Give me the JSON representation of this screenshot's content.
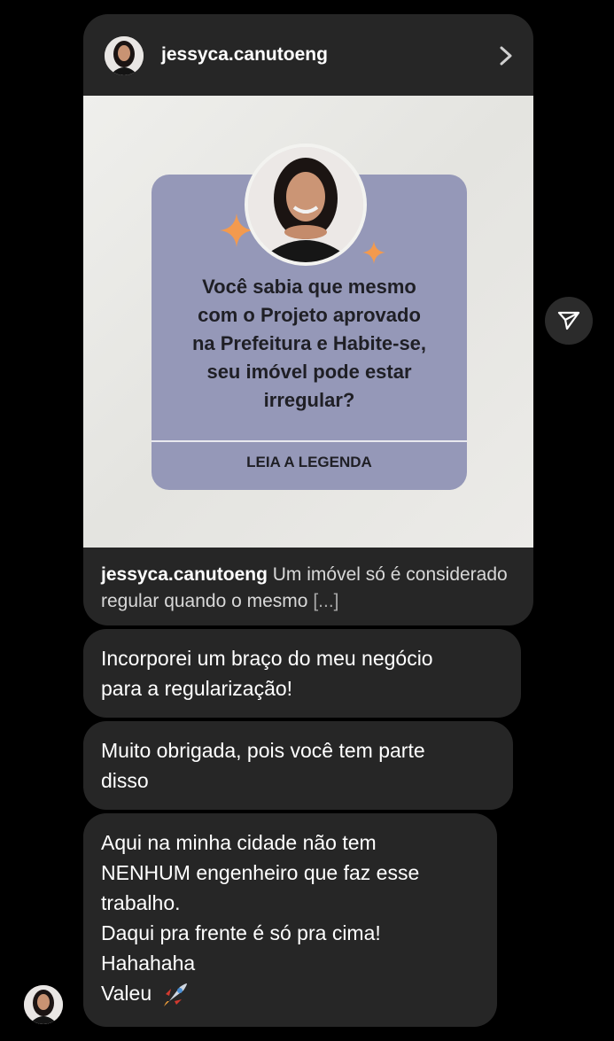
{
  "post": {
    "username": "jessyca.canutoeng",
    "question_lines": [
      "Você sabia que mesmo",
      "com o Projeto aprovado",
      "na Prefeitura e Habite-se,",
      "seu imóvel pode estar",
      "irregular?"
    ],
    "read_label": "LEIA A LEGENDA",
    "caption_user": "jessyca.canutoeng",
    "caption_text": "Um imóvel só é considerado regular quando o mesmo",
    "caption_more": "[...]"
  },
  "messages": [
    {
      "lines": [
        "Incorporei um braço do meu negócio",
        "para a regularização!"
      ]
    },
    {
      "lines": [
        "Muito obrigada, pois você tem parte",
        "disso"
      ]
    },
    {
      "lines": [
        "Aqui na minha cidade não tem",
        "NENHUM engenheiro que faz esse",
        "trabalho.",
        "Daqui pra frente é só pra cima!",
        "Hahahaha",
        "Valeu"
      ]
    }
  ],
  "icons": {
    "header_chevron": "chevron-right-icon",
    "share": "paper-plane-icon",
    "emoji": "rocket-icon",
    "sparkle": "sparkle-icon"
  },
  "colors": {
    "background": "#000000",
    "bubble": "#262626",
    "card": "#9598b8",
    "sparkle": "#f39a4e"
  }
}
